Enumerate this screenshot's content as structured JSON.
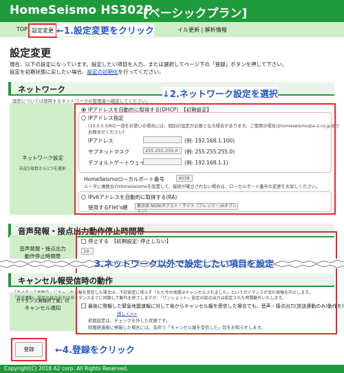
{
  "header": {
    "title": "HomeSeismo HS302P",
    "plan": "[ベーシックプラン]"
  },
  "nav": {
    "top": "TOP",
    "current": "設定変更",
    "rest": "イル更新 | 解析情報"
  },
  "annotations": {
    "step1": "←1.設定変更をクリック",
    "step2": "↓2.ネットワーク設定を選択",
    "step3": "3.ネットワーク以外で設定したい項目を設定",
    "step4": "←4.登録をクリック"
  },
  "page": {
    "title": "設定変更",
    "intro_line1": "現在、以下の設定になっています。設定したい項目を入力、または選択してページ下の「登録」ボタンを押して下さい。",
    "intro_line2_prefix": "設定を初期状態に戻したい場合、",
    "intro_link": "設定の初期化",
    "intro_line2_suffix": "を行ってください。"
  },
  "network": {
    "section_title": "ネットワーク",
    "note": "設定については使用するネットワークの管理者へ確認してください。",
    "label": "ネットワーク設定",
    "label_sub": "右記3項目から1つを選択",
    "dhcp_label": "IPアドレスを自動的に取得する(DHCP)",
    "dhcp_initial": "【初期設定】",
    "static_label": "IPアドレス指定",
    "static_note1": "(10.0.0.0/8の一部をお使いの場合には、個別の設定が必要となる場合があります。ご使用の場合はhomeseismo@a-2.co.jpまで",
    "static_note2": "お問合せください)",
    "ip_label": "IPアドレス",
    "ip_example": "(例: 192.168.1.100)",
    "mask_label": "サブネットマスク",
    "mask_value": "255.255.255.0",
    "mask_example": "(例: 255.255.255.0)",
    "gw_label": "デフォルトゲートウェイ",
    "gw_example": "(例: 192.168.1.1)",
    "port_label": "HomeSeismoローカルポート番号",
    "port_value": "4038",
    "port_note": "ルータに複数台のHomeSeismoを設置して、接続が確立されない場合は、ローカルポート番号の変更をお試しください。",
    "ipv6_label": "IPv6アドレスを自動的に取得する(RA)",
    "flets_label": "使用するFlet's網",
    "flets_value": "東日本 NGN(ネクスト・ライト（フレッツ・v6オプション）"
  },
  "stop_section": {
    "section_title": "音声発報・接点出力動作停止時間帯",
    "label_line1": "音声発報・接点出力",
    "label_line2": "動作停止時間帯",
    "stop_check": "停止する",
    "stop_initial": "【初期設定: 停止しない】",
    "hour_value": "19"
  },
  "cancel_section": {
    "section_title": "キャンセル報受信時の動作",
    "desc1": "「ガイダンス発報中」にキャンセル報を受信した場合は、下記設定に係らず「ただ今の地震はキャンセルされました」というガイダンスが流れ発報を中止します。",
    "desc2": "「放送連動」設定の接点出力はガイダンスまでに同期して動作を終了しますが、「ワンショット」設定の接点出力は設定された時間動作いたします。",
    "label_line1": "ガイダンス発報終了後」の",
    "label_line2": "キャンセル通知",
    "option": "最後に発報した緊急地震速報に対して後からキャンセル報を受信した場合でも、音声・接点出力(放送連動のみ)動作を行う",
    "option_link": "詳しく>>",
    "initial_note": "初期設定は、チェックを外した状態です。",
    "extra_note": "時間経過後に発報した場合には、音声で「キャンセル報を受信した」旨をお知らせします。"
  },
  "buttons": {
    "register": "登録"
  },
  "footer": {
    "copyright": "Copyright(C) 2018 A2 corp. All Rights Reserved."
  },
  "colors": {
    "accent": "#1f9a3a",
    "highlight": "#e8262b",
    "annotation": "#2457c7",
    "nav_bg": "#cfeec7"
  }
}
